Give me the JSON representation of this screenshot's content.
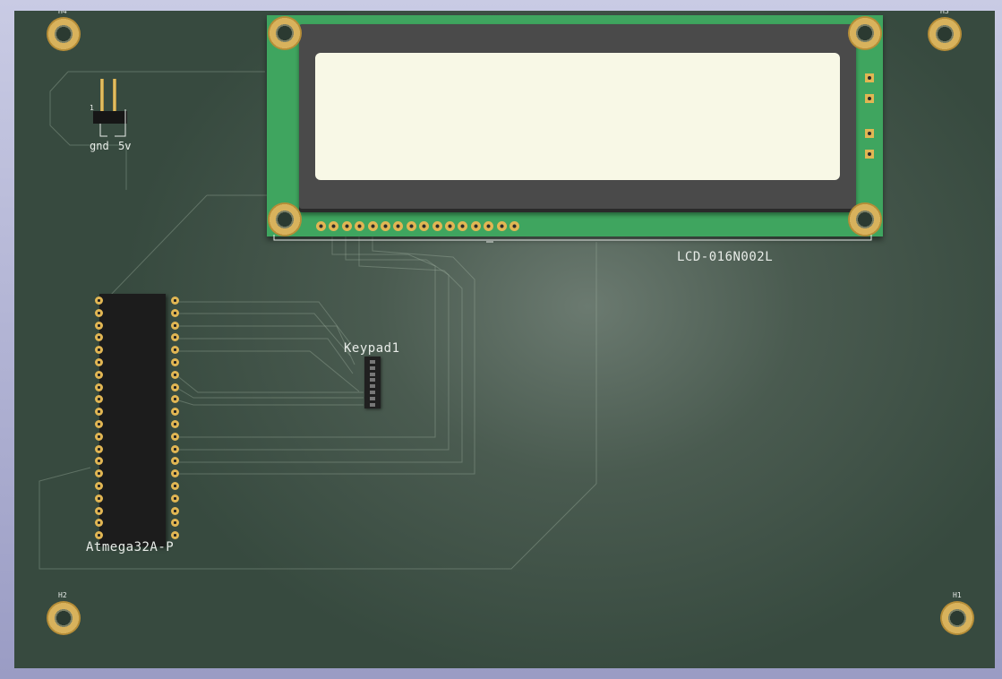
{
  "board": {
    "labels": {
      "h1": "H1",
      "h2": "H2",
      "h3": "H3",
      "h4": "H4",
      "lcd": "LCD-016N002L",
      "keypad": "Keypad1",
      "mcu": "Atmega32A-P",
      "power_gnd": "gnd",
      "power_5v": "5v",
      "pin1_mark": "1"
    }
  },
  "colors": {
    "board": "#3f5246",
    "lcd_pcb": "#3fa55f",
    "lcd_screen": "#f8f8e6",
    "pad_gold": "#e1b653",
    "silkscreen": "#e8ece8"
  },
  "components": {
    "lcd_pin_count": 16,
    "mcu_pins_per_side": 20,
    "keypad_pin_count": 8
  }
}
